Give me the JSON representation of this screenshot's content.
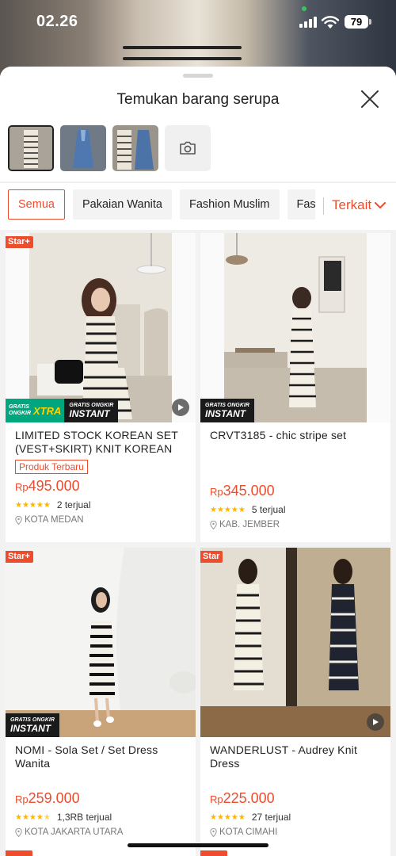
{
  "status_bar": {
    "time": "02.26",
    "battery": "79"
  },
  "sheet": {
    "title": "Temukan barang serupa"
  },
  "thumbnails": [
    {
      "name": "thumb-stripe-set",
      "selected": true
    },
    {
      "name": "thumb-denim-dress",
      "selected": false
    },
    {
      "name": "thumb-stripe-denim",
      "selected": false
    }
  ],
  "filters": {
    "chips": [
      "Semua",
      "Pakaian Wanita",
      "Fashion Muslim",
      "Fash"
    ],
    "active_index": 0,
    "sort_label": "Terkait"
  },
  "products": [
    {
      "badge": "Star+",
      "shipping": {
        "xtra": true,
        "instant": true
      },
      "video": true,
      "title": "LIMITED STOCK KOREAN SET (VEST+SKIRT) KNIT KOREAN S...",
      "tag": "Produk Terbaru",
      "currency": "Rp",
      "price": "495.000",
      "rating": 5,
      "sold": "2 terjual",
      "location": "KOTA MEDAN"
    },
    {
      "badge": "",
      "shipping": {
        "xtra": false,
        "instant": true
      },
      "video": false,
      "title": "CRVT3185 - chic stripe set",
      "tag": "",
      "currency": "Rp",
      "price": "345.000",
      "rating": 5,
      "sold": "5 terjual",
      "location": "KAB. JEMBER"
    },
    {
      "badge": "Star+",
      "shipping": {
        "xtra": false,
        "instant": true
      },
      "video": false,
      "title": "NOMI - Sola Set / Set Dress Wanita",
      "tag": "",
      "currency": "Rp",
      "price": "259.000",
      "rating": 4.5,
      "sold": "1,3RB terjual",
      "location": "KOTA JAKARTA UTARA"
    },
    {
      "badge": "Star",
      "shipping": {
        "xtra": false,
        "instant": false
      },
      "video": true,
      "title": "WANDERLUST - Audrey Knit Dress",
      "tag": "",
      "currency": "Rp",
      "price": "225.000",
      "rating": 5,
      "sold": "27 terjual",
      "location": "KOTA CIMAHI"
    }
  ],
  "shipping_labels": {
    "gratis": "GRATIS",
    "ongkir": "ONGKIR",
    "xtra": "XTRA",
    "gratis_ongkir": "GRATIS ONGKIR",
    "instant": "INSTANT"
  },
  "colors": {
    "accent": "#ee4d2d",
    "star": "#ffb400",
    "xtra_green": "#00a77e"
  }
}
